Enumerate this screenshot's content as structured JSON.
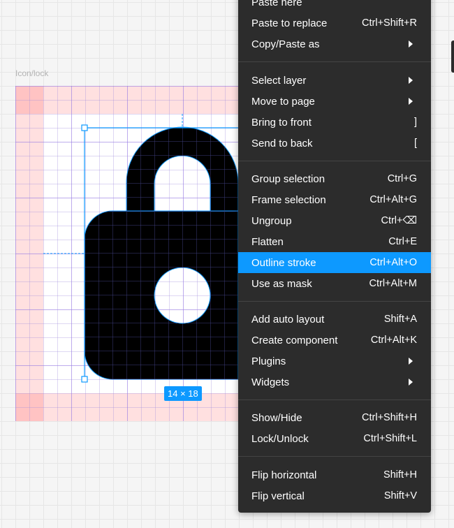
{
  "canvas": {
    "frame_label": "Icon/lock",
    "dimension_badge": "14 × 18"
  },
  "menu": {
    "items": [
      {
        "label": "Paste here",
        "shortcut": ""
      },
      {
        "label": "Paste to replace",
        "shortcut": "Ctrl+Shift+R"
      },
      {
        "label": "Copy/Paste as",
        "shortcut": "",
        "submenu": true
      },
      {
        "label": "Select layer",
        "shortcut": "",
        "submenu": true
      },
      {
        "label": "Move to page",
        "shortcut": "",
        "submenu": true
      },
      {
        "label": "Bring to front",
        "shortcut": "]"
      },
      {
        "label": "Send to back",
        "shortcut": "["
      },
      {
        "label": "Group selection",
        "shortcut": "Ctrl+G"
      },
      {
        "label": "Frame selection",
        "shortcut": "Ctrl+Alt+G"
      },
      {
        "label": "Ungroup",
        "shortcut": "Ctrl+⌫"
      },
      {
        "label": "Flatten",
        "shortcut": "Ctrl+E"
      },
      {
        "label": "Outline stroke",
        "shortcut": "Ctrl+Alt+O",
        "active": true
      },
      {
        "label": "Use as mask",
        "shortcut": "Ctrl+Alt+M"
      },
      {
        "label": "Add auto layout",
        "shortcut": "Shift+A"
      },
      {
        "label": "Create component",
        "shortcut": "Ctrl+Alt+K"
      },
      {
        "label": "Plugins",
        "shortcut": "",
        "submenu": true
      },
      {
        "label": "Widgets",
        "shortcut": "",
        "submenu": true
      },
      {
        "label": "Show/Hide",
        "shortcut": "Ctrl+Shift+H"
      },
      {
        "label": "Lock/Unlock",
        "shortcut": "Ctrl+Shift+L"
      },
      {
        "label": "Flip horizontal",
        "shortcut": "Shift+H"
      },
      {
        "label": "Flip vertical",
        "shortcut": "Shift+V"
      }
    ]
  },
  "colors": {
    "selection": "#0d99ff",
    "menu_bg": "#2c2c2c",
    "icon_fill": "#000000"
  }
}
